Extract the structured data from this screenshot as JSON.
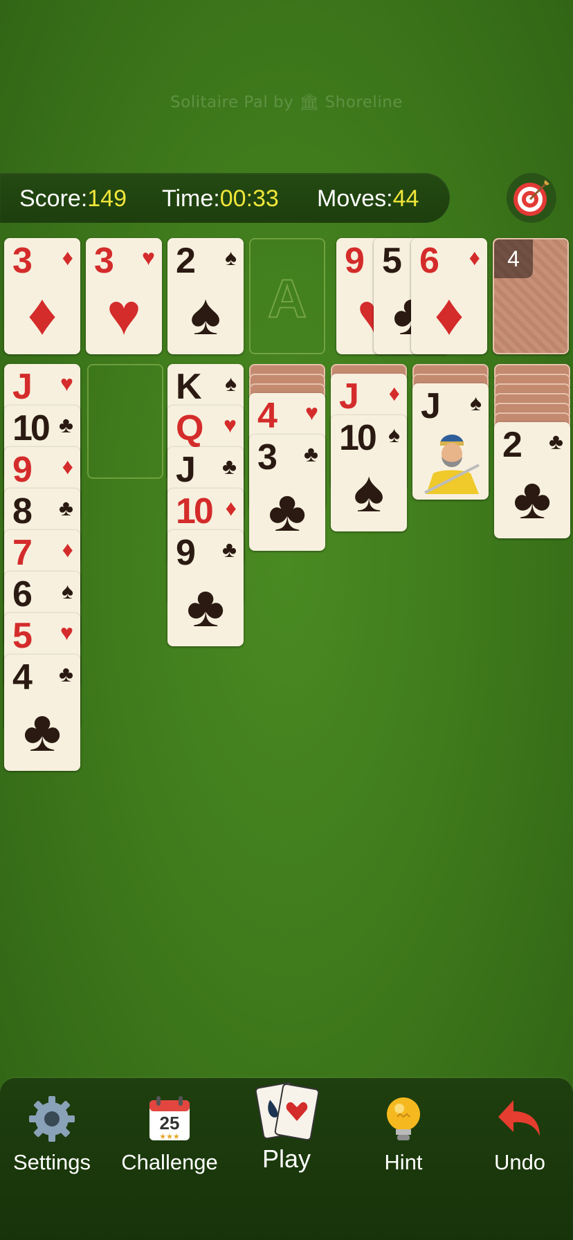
{
  "header": {
    "title": "Solitaire Pal by 🏛 Shoreline"
  },
  "status": {
    "score_label": "Score:",
    "score_value": "149",
    "time_label": "Time:",
    "time_value": "00:33",
    "moves_label": "Moves:",
    "moves_value": "44"
  },
  "foundations": [
    {
      "rank": "3",
      "suit": "♦",
      "color": "red"
    },
    {
      "rank": "3",
      "suit": "♥",
      "color": "red"
    },
    {
      "rank": "2",
      "suit": "♠",
      "color": "black"
    },
    {
      "empty_label": "A"
    }
  ],
  "waste": [
    {
      "rank": "9",
      "suit": "♥",
      "color": "red"
    },
    {
      "rank": "5",
      "suit": "♣",
      "color": "black"
    },
    {
      "rank": "6",
      "suit": "♦",
      "color": "red"
    }
  ],
  "stock": {
    "count": "4"
  },
  "tableau": [
    {
      "hidden": 0,
      "cards": [
        {
          "rank": "J",
          "suit": "♥",
          "color": "red"
        },
        {
          "rank": "10",
          "suit": "♣",
          "color": "black"
        },
        {
          "rank": "9",
          "suit": "♦",
          "color": "red"
        },
        {
          "rank": "8",
          "suit": "♣",
          "color": "black"
        },
        {
          "rank": "7",
          "suit": "♦",
          "color": "red"
        },
        {
          "rank": "6",
          "suit": "♠",
          "color": "black"
        },
        {
          "rank": "5",
          "suit": "♥",
          "color": "red"
        },
        {
          "rank": "4",
          "suit": "♣",
          "color": "black"
        }
      ]
    },
    {
      "hidden": 0,
      "cards": []
    },
    {
      "hidden": 0,
      "cards": [
        {
          "rank": "K",
          "suit": "♠",
          "color": "black"
        },
        {
          "rank": "Q",
          "suit": "♥",
          "color": "red"
        },
        {
          "rank": "J",
          "suit": "♣",
          "color": "black"
        },
        {
          "rank": "10",
          "suit": "♦",
          "color": "red"
        },
        {
          "rank": "9",
          "suit": "♣",
          "color": "black"
        }
      ]
    },
    {
      "hidden": 3,
      "cards": [
        {
          "rank": "4",
          "suit": "♥",
          "color": "red"
        },
        {
          "rank": "3",
          "suit": "♣",
          "color": "black"
        }
      ]
    },
    {
      "hidden": 1,
      "cards": [
        {
          "rank": "J",
          "suit": "♦",
          "color": "red"
        },
        {
          "rank": "10",
          "suit": "♠",
          "color": "black"
        }
      ]
    },
    {
      "hidden": 2,
      "cards": [
        {
          "rank": "J",
          "suit": "♠",
          "color": "black",
          "face": true
        }
      ]
    },
    {
      "hidden": 6,
      "cards": [
        {
          "rank": "2",
          "suit": "♣",
          "color": "black"
        }
      ]
    }
  ],
  "toolbar": {
    "settings": "Settings",
    "challenge": "Challenge",
    "challenge_day": "25",
    "play": "Play",
    "hint": "Hint",
    "undo": "Undo"
  }
}
